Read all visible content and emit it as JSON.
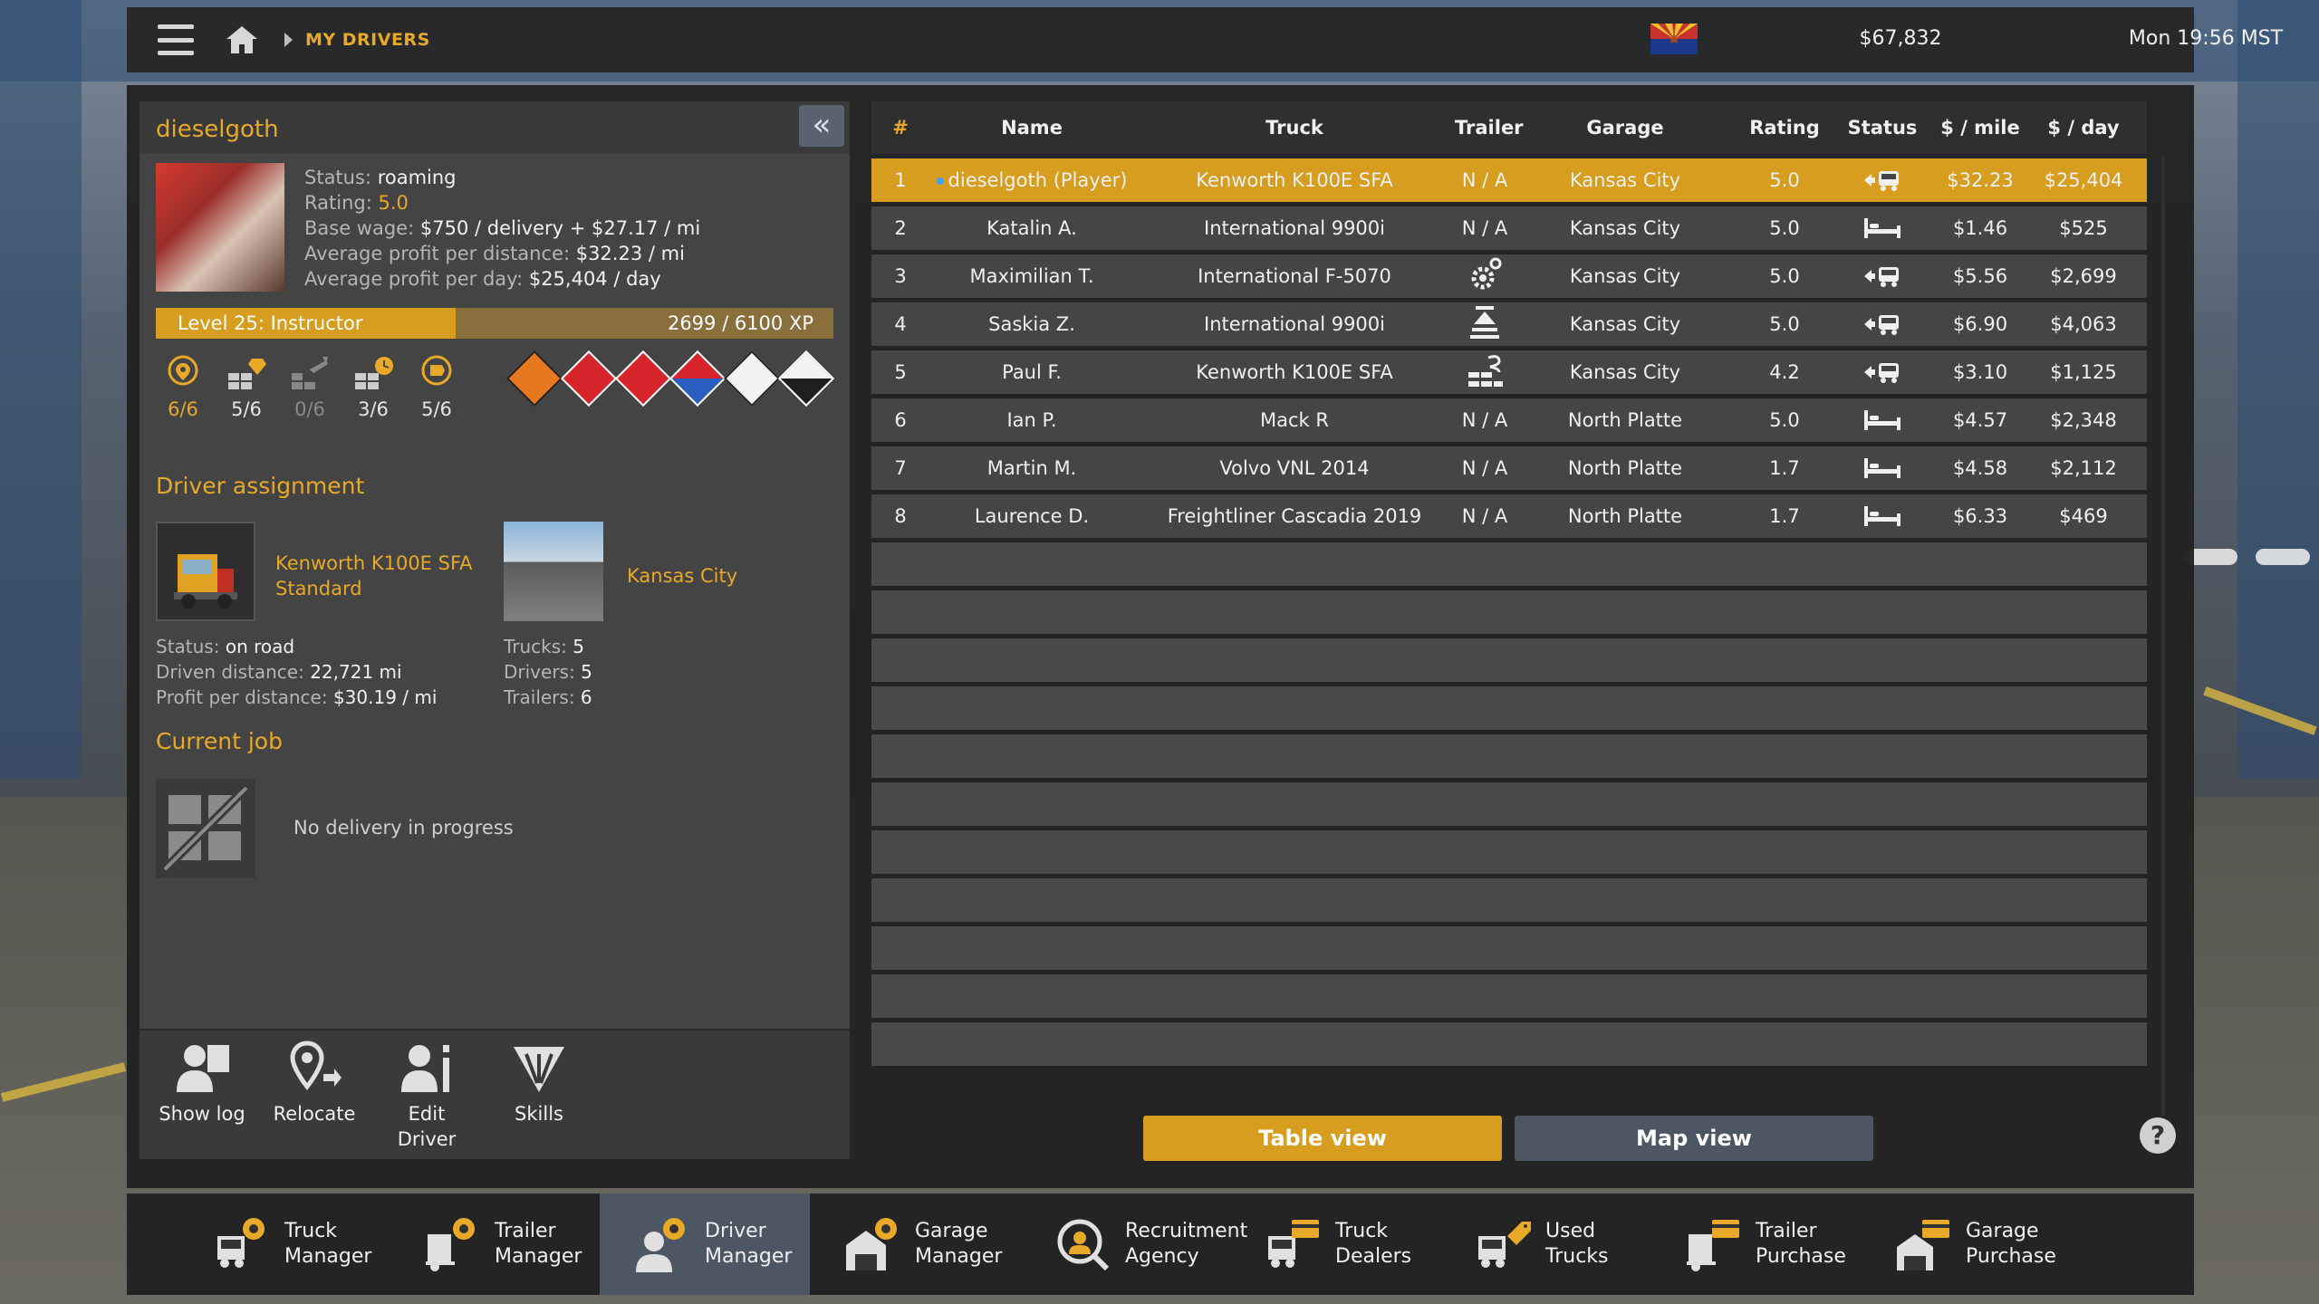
{
  "topbar": {
    "breadcrumb": "MY DRIVERS",
    "money": "$67,832",
    "clock": "Mon 19:56 MST"
  },
  "driver": {
    "name": "dieselgoth",
    "status_label": "Status:",
    "status_value": "roaming",
    "rating_label": "Rating:",
    "rating_value": "5.0",
    "wage_label": "Base wage:",
    "wage_value": "$750 / delivery + $27.17 / mi",
    "avg_dist_label": "Average profit per distance:",
    "avg_dist_value": "$32.23 / mi",
    "avg_day_label": "Average profit per day:",
    "avg_day_value": "$25,404 / day",
    "level_label": "Level 25: Instructor",
    "xp": "2699 / 6100 XP",
    "xp_fraction": 0.4425,
    "skills": [
      {
        "icon": "adr-location-icon",
        "value": "6/6",
        "accent": "#e8a928"
      },
      {
        "icon": "long-distance-icon",
        "value": "5/6",
        "accent": "#e6e6e6"
      },
      {
        "icon": "high-value-cargo-icon",
        "value": "0/6",
        "accent": "#8a8a8a"
      },
      {
        "icon": "fragile-cargo-icon",
        "value": "3/6",
        "accent": "#e6e6e6"
      },
      {
        "icon": "just-in-time-icon",
        "value": "5/6",
        "accent": "#e6e6e6"
      }
    ],
    "adr_classes": [
      {
        "name": "explosives-icon",
        "color": "#e8781e",
        "text": "EXPLOSIVES"
      },
      {
        "name": "flammable-gas-icon",
        "color": "#d7262b",
        "text": "FLAMMABLE GAS"
      },
      {
        "name": "flammable-liquid-icon",
        "color": "#d7262b",
        "text": "FLAMMABLE"
      },
      {
        "name": "dangerous-when-wet-icon",
        "color": "#d7262b",
        "text": ""
      },
      {
        "name": "toxic-icon",
        "color": "#f2f2f2",
        "text": ""
      },
      {
        "name": "corrosive-icon",
        "color": "#f2f2f2",
        "text": ""
      }
    ]
  },
  "assignment": {
    "title": "Driver assignment",
    "truck_line1": "Kenworth  K100E SFA",
    "truck_line2": "Standard",
    "garage": "Kansas City",
    "status_label": "Status:",
    "status_value": "on road",
    "driven_label": "Driven distance:",
    "driven_value": "22,721 mi",
    "ppd_label": "Profit per distance:",
    "ppd_value": "$30.19 / mi",
    "trucks_label": "Trucks:",
    "trucks_value": "5",
    "drivers_label": "Drivers:",
    "drivers_value": "5",
    "trailers_label": "Trailers:",
    "trailers_value": "6"
  },
  "current_job": {
    "title": "Current job",
    "text": "No delivery in progress"
  },
  "actions": [
    {
      "label": "Show log",
      "icon": "show-log-icon"
    },
    {
      "label": "Relocate",
      "icon": "relocate-icon"
    },
    {
      "label": "Edit Driver",
      "icon": "edit-driver-icon"
    },
    {
      "label": "Skills",
      "icon": "skills-icon"
    }
  ],
  "table": {
    "headers": [
      "#",
      "Name",
      "Truck",
      "Trailer",
      "Garage",
      "Rating",
      "Status",
      "$ / mile",
      "$ / day"
    ],
    "rows": [
      {
        "num": "1",
        "name": "dieselgoth (Player)",
        "truck": "Kenworth  K100E SFA",
        "trailer": "N / A",
        "garage": "Kansas City",
        "rating": "5.0",
        "status": "driving",
        "mile": "$32.23",
        "day": "$25,404",
        "player": true
      },
      {
        "num": "2",
        "name": "Katalin A.",
        "truck": "International 9900i",
        "trailer": "N / A",
        "garage": "Kansas City",
        "rating": "5.0",
        "status": "resting",
        "mile": "$1.46",
        "day": "$525"
      },
      {
        "num": "3",
        "name": "Maximilian T.",
        "truck": "International F-5070",
        "trailer": "trailer-gear",
        "garage": "Kansas City",
        "rating": "5.0",
        "status": "driving",
        "mile": "$5.56",
        "day": "$2,699"
      },
      {
        "num": "4",
        "name": "Saskia Z.",
        "truck": "International 9900i",
        "trailer": "trailer-crane",
        "garage": "Kansas City",
        "rating": "5.0",
        "status": "driving",
        "mile": "$6.90",
        "day": "$4,063"
      },
      {
        "num": "5",
        "name": "Paul F.",
        "truck": "Kenworth  K100E SFA",
        "trailer": "trailer-bricks",
        "garage": "Kansas City",
        "rating": "4.2",
        "status": "driving",
        "mile": "$3.10",
        "day": "$1,125"
      },
      {
        "num": "6",
        "name": "Ian P.",
        "truck": "Mack R",
        "trailer": "N / A",
        "garage": "North Platte",
        "rating": "5.0",
        "status": "resting",
        "mile": "$4.57",
        "day": "$2,348"
      },
      {
        "num": "7",
        "name": "Martin M.",
        "truck": "Volvo VNL 2014",
        "trailer": "N / A",
        "garage": "North Platte",
        "rating": "1.7",
        "status": "resting",
        "mile": "$4.58",
        "day": "$2,112"
      },
      {
        "num": "8",
        "name": "Laurence D.",
        "truck": "Freightliner Cascadia 2019",
        "trailer": "N / A",
        "garage": "North Platte",
        "rating": "1.7",
        "status": "resting",
        "mile": "$6.33",
        "day": "$469"
      }
    ],
    "empty_rows": 11
  },
  "views": {
    "table": "Table view",
    "map": "Map view",
    "help": "?"
  },
  "colors": {
    "accent": "#e8a928",
    "selected_row": "#d79d1e",
    "map_button": "#4d5663"
  },
  "nav": [
    {
      "line1": "Truck",
      "line2": "Manager",
      "icon": "truck-manager-icon"
    },
    {
      "line1": "Trailer",
      "line2": "Manager",
      "icon": "trailer-manager-icon"
    },
    {
      "line1": "Driver",
      "line2": "Manager",
      "icon": "driver-manager-icon",
      "active": true
    },
    {
      "line1": "Garage",
      "line2": "Manager",
      "icon": "garage-manager-icon"
    },
    {
      "line1": "Recruitment",
      "line2": "Agency",
      "icon": "recruitment-agency-icon"
    },
    {
      "line1": "Truck",
      "line2": "Dealers",
      "icon": "truck-dealers-icon"
    },
    {
      "line1": "Used Trucks",
      "line2": "",
      "icon": "used-trucks-icon"
    },
    {
      "line1": "Trailer",
      "line2": "Purchase",
      "icon": "trailer-purchase-icon"
    },
    {
      "line1": "Garage",
      "line2": "Purchase",
      "icon": "garage-purchase-icon"
    }
  ]
}
